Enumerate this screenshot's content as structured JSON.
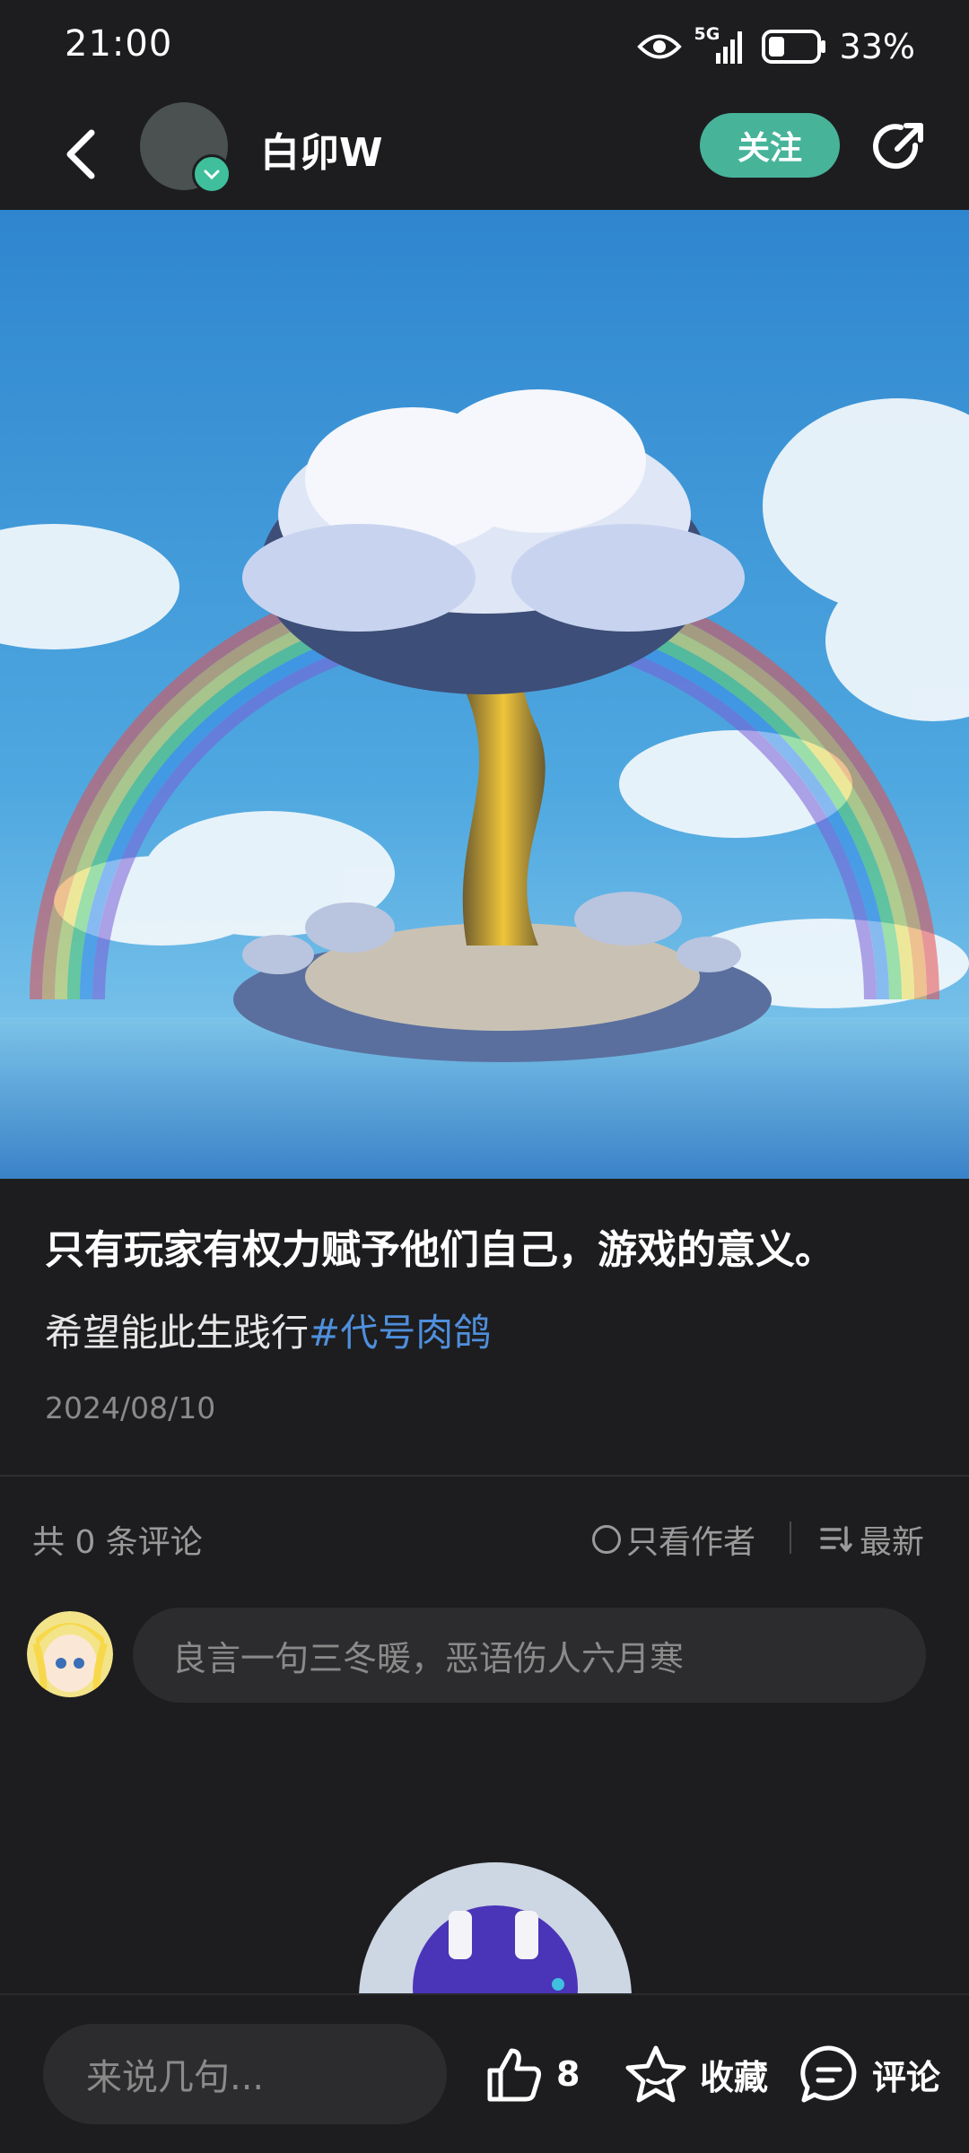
{
  "status_bar": {
    "time": "21:00",
    "network": "5G",
    "battery": "33%",
    "battery_level": 0.33
  },
  "header": {
    "username": "白卯W",
    "follow_label": "关注"
  },
  "post": {
    "title": "只有玩家有权力赋予他们自己，游戏的意义。",
    "desc_text": "希望能此生践行",
    "hashtag": "#代号肉鸽",
    "date": "2024/08/10"
  },
  "comments": {
    "count_label": "共 0 条评论",
    "author_only_label": "只看作者",
    "sort_label": "最新",
    "input_placeholder": "良言一句三冬暖，恶语伤人六月寒"
  },
  "bottom_bar": {
    "input_placeholder": "来说几句...",
    "like_count": "8",
    "favorite_label": "收藏",
    "comment_label": "评论"
  },
  "colors": {
    "accent": "#47b49a",
    "hashtag": "#4f8fdc",
    "background": "#1d1d1f"
  }
}
